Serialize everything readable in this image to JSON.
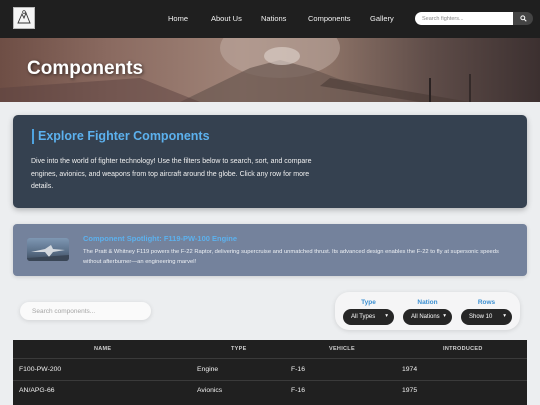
{
  "nav": {
    "links": [
      "Home",
      "About Us",
      "Nations",
      "Components",
      "Gallery"
    ],
    "search_placeholder": "Search fighters..."
  },
  "hero": {
    "title": "Components"
  },
  "intro": {
    "title": "Explore Fighter Components",
    "text": "Dive into the world of fighter technology! Use the filters below to search, sort, and compare engines, avionics, and weapons from top aircraft around the globe. Click any row for more details."
  },
  "spotlight": {
    "title": "Component Spotlight: F119-PW-100 Engine",
    "text": "The Pratt & Whitney F119 powers the F-22 Raptor, delivering supercruise and unmatched thrust. Its advanced design enables the F-22 to fly at supersonic speeds without afterburner—an engineering marvel!"
  },
  "filters": {
    "search_placeholder": "Search components...",
    "type_label": "Type",
    "type_value": "All Types",
    "nation_label": "Nation",
    "nation_value": "All Nations",
    "rows_label": "Rows",
    "rows_value": "Show 10"
  },
  "table": {
    "headers": [
      "NAME",
      "TYPE",
      "VEHICLE",
      "INTRODUCED"
    ],
    "rows": [
      [
        "F100-PW-200",
        "Engine",
        "F-16",
        "1974"
      ],
      [
        "AN/APG-66",
        "Avionics",
        "F-16",
        "1975"
      ]
    ]
  }
}
